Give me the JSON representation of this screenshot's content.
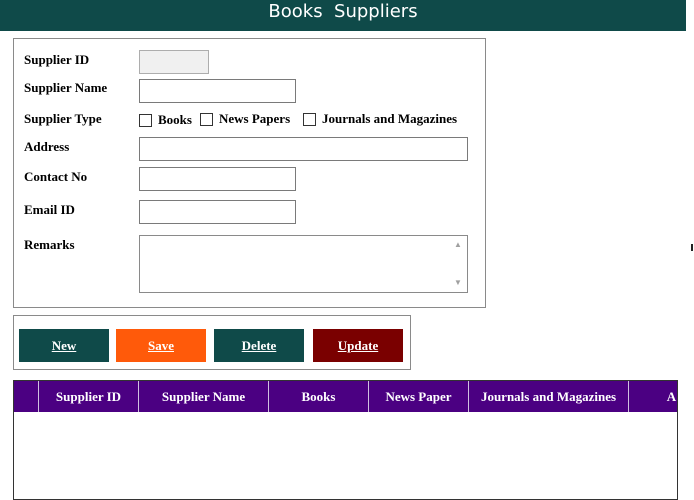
{
  "header": {
    "title": "Books  Suppliers",
    "bg": "#0f4a49"
  },
  "form": {
    "supplier_id_label": "Supplier ID",
    "supplier_id_value": "",
    "supplier_name_label": "Supplier Name",
    "supplier_name_value": "",
    "supplier_type_label": "Supplier Type",
    "types": [
      {
        "label": "Books",
        "checked": false
      },
      {
        "label": "News Papers",
        "checked": false
      },
      {
        "label": "Journals and Magazines",
        "checked": false
      }
    ],
    "address_label": "Address",
    "address_value": "",
    "contact_label": "Contact No",
    "contact_value": "",
    "email_label": "Email ID",
    "email_value": "",
    "remarks_label": "Remarks",
    "remarks_value": ""
  },
  "buttons": {
    "new": {
      "label": "New",
      "color": "#0f4a49"
    },
    "save": {
      "label": "Save",
      "color": "#ff5a0a"
    },
    "delete": {
      "label": "Delete",
      "color": "#0f4a49"
    },
    "update": {
      "label": "Update",
      "color": "#7a0000"
    }
  },
  "grid": {
    "header_bg": "#4b0082",
    "columns": [
      "",
      "Supplier ID",
      "Supplier Name",
      "Books",
      "News Paper",
      "Journals and Magazines",
      "A"
    ],
    "rows": []
  }
}
